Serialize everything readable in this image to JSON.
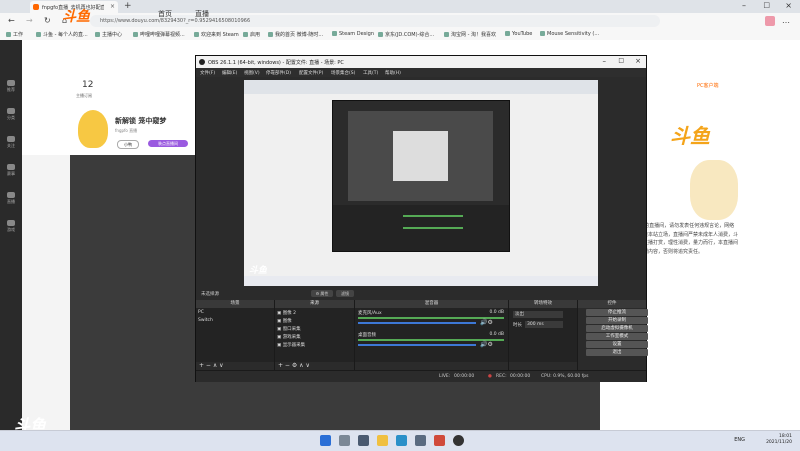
{
  "browser": {
    "tab_title": "fnpgfo直播_去机再也好配直播",
    "url": "https://www.douyu.com/8329430?_r=0.9529416508010966",
    "bookmarks": [
      "工作",
      "斗鱼 - 每个人的直...",
      "主播中心",
      "哔哩哔哩弹幕视频...",
      "欢迎来到 Steam",
      "启用",
      "我的首页 微博-随时...",
      "Steam Design",
      "京东(JD.COM)-综合...",
      "淘宝网 - 淘！我喜欢",
      "YouTube",
      "Mouse Sensitivity (..."
    ]
  },
  "douyu": {
    "logo": "斗鱼",
    "nav": [
      "首页",
      "直播"
    ],
    "left_nav": [
      "推荐",
      "分类",
      "关注",
      "赛事",
      "直播",
      "游戏"
    ],
    "follow_count": "12",
    "follow_label": "主播订阅",
    "title": "新解锁 笼中窥梦",
    "streamer": "fngpfo 直播",
    "tag1": "小鸭",
    "tag2": "装点直播间",
    "pc_client": "PC客户端",
    "description": "欢迎来到fngpfo的直播间，请勿发表任何违规言论，网络直播，弹幕不代表本站立场，直播间严禁未成年人消费，斗鱼不鼓励用户向主播打赏，理性消费，量力而行，本直播间不得传播违法违规内容，否则将追究责任。",
    "watermark": "斗鱼"
  },
  "obs": {
    "title": "OBS 26.1.1 (64-bit, windows) - 配置文件: 直播 - 场景: PC",
    "menus": [
      "文件(F)",
      "编辑(E)",
      "视图(V)",
      "停靠部件(D)",
      "配置文件(P)",
      "场景集合(S)",
      "工具(T)",
      "帮助(H)"
    ],
    "no_source": "未选择源",
    "properties": "属性",
    "filters": "滤镜",
    "docks": {
      "scenes": "场景",
      "sources": "来源",
      "mixer": "混音器",
      "transitions": "转场特效",
      "controls": "控件"
    },
    "scenes": [
      "PC",
      "Switch"
    ],
    "sources": [
      "图像 2",
      "图像",
      "窗口采集",
      "游戏采集",
      "显示器采集"
    ],
    "mixer": [
      {
        "name": "麦克风/Aux",
        "db": "0.0 dB"
      },
      {
        "name": "桌面音频",
        "db": "0.0 dB"
      }
    ],
    "transition": {
      "type": "淡出",
      "duration_label": "时长",
      "duration": "300 ms"
    },
    "controls": [
      "停止推流",
      "开始录制",
      "启动虚拟摄像机",
      "工作室模式",
      "设置",
      "退出"
    ],
    "status": {
      "live_label": "LIVE:",
      "live_time": "00:00:00",
      "rec_label": "REC:",
      "rec_time": "00:00:00",
      "cpu": "CPU: 0.9%, 60.00 fps"
    }
  },
  "taskbar": {
    "lang": "ENG",
    "time": "18:01",
    "date": "2021/11/20"
  }
}
